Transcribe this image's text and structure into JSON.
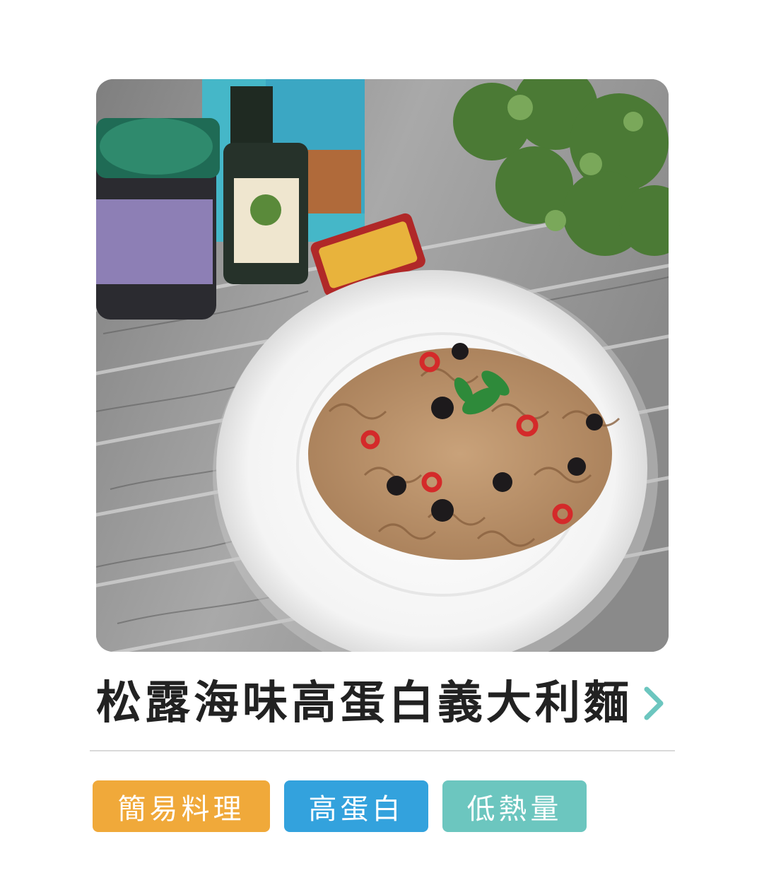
{
  "recipe": {
    "title": "松露海味高蛋白義大利麵",
    "chevron_icon": "chevron-right-icon",
    "photo_icon": "pasta-dish-photo",
    "accent_color": "#6cc6bf"
  },
  "tags": [
    {
      "label": "簡易料理",
      "color": "#f0a93a"
    },
    {
      "label": "高蛋白",
      "color": "#33a2dd"
    },
    {
      "label": "低熱量",
      "color": "#6cc6bf"
    }
  ]
}
